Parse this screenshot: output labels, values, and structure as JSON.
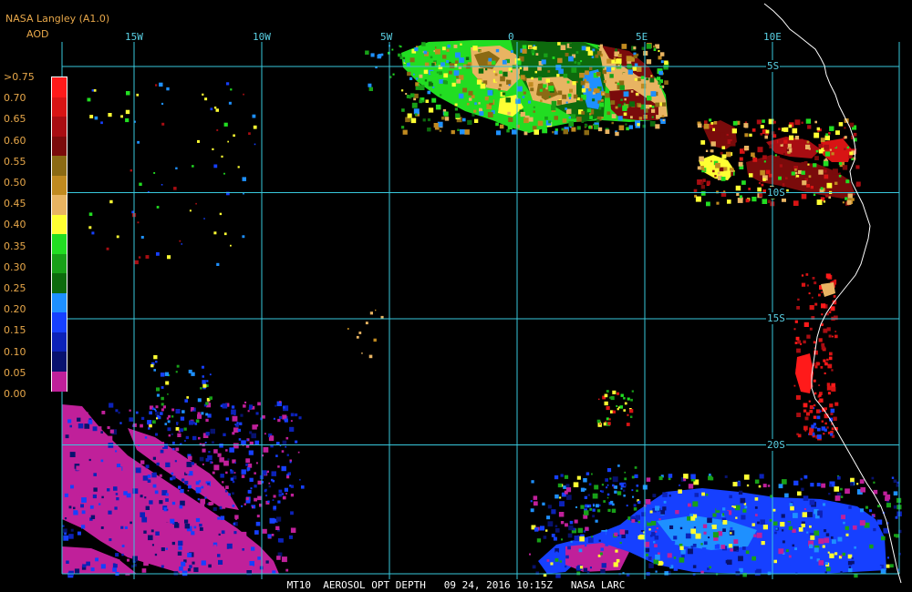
{
  "header": {
    "title": "NASA Langley (A1.0)",
    "product": "AOD"
  },
  "map": {
    "longitude_labels": [
      {
        "text": "15W",
        "lon": -15
      },
      {
        "text": "10W",
        "lon": -10
      },
      {
        "text": "5W",
        "lon": -5
      },
      {
        "text": "0",
        "lon": 0
      },
      {
        "text": "5E",
        "lon": 5
      },
      {
        "text": "10E",
        "lon": 10
      }
    ],
    "latitude_labels": [
      {
        "text": "5S",
        "lat": -5
      },
      {
        "text": "10S",
        "lat": -10
      },
      {
        "text": "15S",
        "lat": -15
      },
      {
        "text": "20S",
        "lat": -20
      }
    ],
    "grid_color": "#38c8dc",
    "coastline_color": "#ffffff"
  },
  "legend": {
    "entries": [
      {
        "label": ">0.75",
        "color": "#ff1a1a"
      },
      {
        "label": "0.70",
        "color": "#d81414"
      },
      {
        "label": "0.65",
        "color": "#a80d12"
      },
      {
        "label": "0.60",
        "color": "#7a0b0b"
      },
      {
        "label": "0.55",
        "color": "#8b6a14"
      },
      {
        "label": "0.50",
        "color": "#c08a20"
      },
      {
        "label": "0.45",
        "color": "#e8b462"
      },
      {
        "label": "0.40",
        "color": "#ffff33"
      },
      {
        "label": "0.35",
        "color": "#22dd22"
      },
      {
        "label": "0.30",
        "color": "#18a018"
      },
      {
        "label": "0.25",
        "color": "#0d6a0d"
      },
      {
        "label": "0.20",
        "color": "#1e90ff"
      },
      {
        "label": "0.15",
        "color": "#1640ff"
      },
      {
        "label": "0.10",
        "color": "#0c22b8"
      },
      {
        "label": "0.05",
        "color": "#08126e"
      },
      {
        "label": "0.00",
        "color": "#c0209a"
      }
    ]
  },
  "footer": {
    "text": "MT10  AEROSOL OPT DEPTH   09 24, 2016 10:15Z   NASA LARC"
  }
}
